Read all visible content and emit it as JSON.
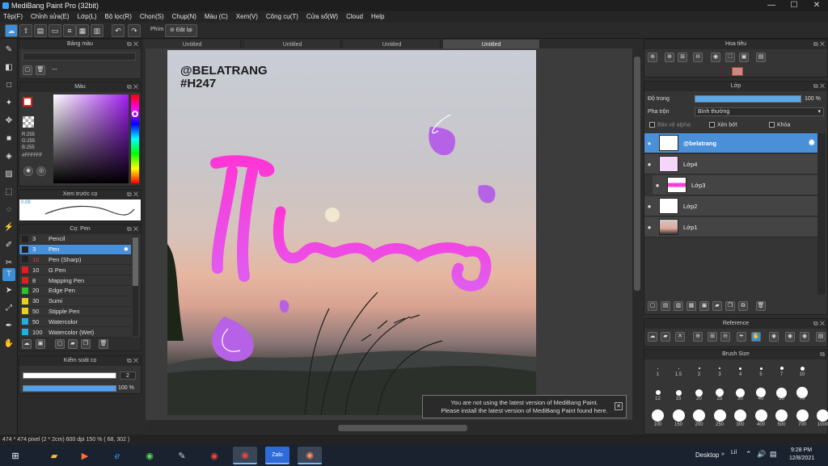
{
  "window": {
    "title": "MediBang Paint Pro (32bit)",
    "min": "—",
    "max": "☐",
    "close": "✕"
  },
  "menu": [
    "Tệp(F)",
    "Chỉnh sửa(E)",
    "Lớp(L)",
    "Bộ lọc(R)",
    "Chọn(S)",
    "Chụp(N)",
    "Màu (C)",
    "Xem(V)",
    "Công cụ(T)",
    "Cửa sổ(W)",
    "Cloud",
    "Help"
  ],
  "toolbar": {
    "shortcut_label": "Phím",
    "reset_label": "Đặt lại"
  },
  "tabs": [
    "Untitled",
    "Untitled",
    "Untitled",
    "Untitled"
  ],
  "palette_panel": {
    "title": "Bảng màu",
    "dash": "---"
  },
  "color_panel": {
    "title": "Màu",
    "r": "R:255",
    "g": "G:255",
    "b": "B:255",
    "hex": "#FFFFFF"
  },
  "preview_panel": {
    "title": "Xem trước cọ",
    "size": "0.08"
  },
  "brush_panel": {
    "title": "Cọ: Pen",
    "items": [
      {
        "num": "3",
        "name": "Pencil",
        "color": "#222222"
      },
      {
        "num": "3",
        "name": "Pen",
        "color": "#222222"
      },
      {
        "num": "10",
        "name": "Pen (Sharp)",
        "color": "#222222"
      },
      {
        "num": "10",
        "name": "G Pen",
        "color": "#e02020"
      },
      {
        "num": "8",
        "name": "Mapping Pen",
        "color": "#e02020"
      },
      {
        "num": "20",
        "name": "Edge Pen",
        "color": "#2ec02e"
      },
      {
        "num": "30",
        "name": "Sumi",
        "color": "#e8d020"
      },
      {
        "num": "50",
        "name": "Stipple Pen",
        "color": "#e8d020"
      },
      {
        "num": "50",
        "name": "Watercolor",
        "color": "#20b0e0"
      },
      {
        "num": "100",
        "name": "Watercolor (Wet)",
        "color": "#20b0e0"
      }
    ]
  },
  "control_panel": {
    "title": "Kiểm soát cọ",
    "size_value": "2",
    "opacity_value": "100 %",
    "opacity": 1.0
  },
  "navigator": {
    "title": "Hoa tiêu"
  },
  "layer_panel": {
    "title": "Lớp",
    "opacity_label": "Độ trong",
    "opacity_value": "100 %",
    "blend_label": "Pha trộn",
    "blend_value": "Bình thường",
    "protect_alpha": "Bảo vệ alpha",
    "clip": "Xén bớt",
    "lock": "Khóa",
    "layers": [
      "@belatrang",
      "Lớp4",
      "Lớp3",
      "Lớp2",
      "Lớp1"
    ]
  },
  "reference_panel": {
    "title": "Reference"
  },
  "brush_size_panel": {
    "title": "Brush Size",
    "row1": [
      "1",
      "1.5",
      "2",
      "3",
      "4",
      "5",
      "7",
      "10"
    ],
    "row2": [
      "12",
      "15",
      "20",
      "25",
      "30",
      "40",
      "50",
      "70"
    ],
    "row3": [
      "100",
      "150",
      "200",
      "250",
      "300",
      "400",
      "500",
      "700",
      "1000"
    ]
  },
  "artwork": {
    "tag1": "@BELATRANG",
    "tag2": "#H247",
    "lettering": "Thương"
  },
  "notice": {
    "line1": "You are not using the latest version of MediBang Paint.",
    "line2": "Please install the latest version of MediBang Paint found here.",
    "close": "✕"
  },
  "statusbar": {
    "text": "474 * 474 pixel  (2 * 2cm)  600 dpi  150 %  ( 68, 302 )"
  },
  "taskbar": {
    "desktop": "Desktop",
    "lang": "Lil",
    "time": "9:28 PM",
    "date": "12/8/2021",
    "zalo": "Zalo"
  },
  "colors": {
    "accent": "#4a90d9",
    "pink": "#ff3fd2",
    "purple": "#b060e8"
  }
}
